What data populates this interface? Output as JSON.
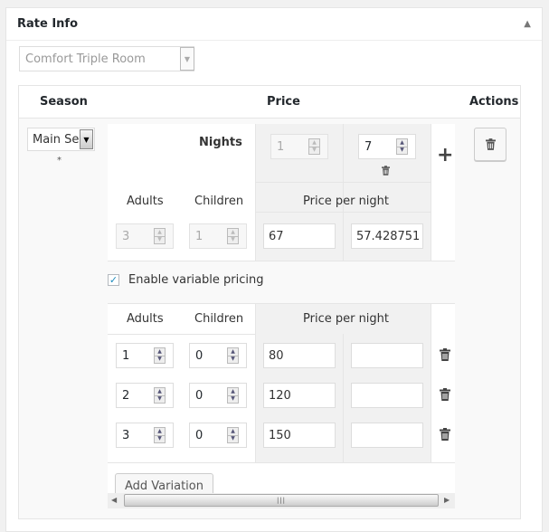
{
  "panel": {
    "title": "Rate Info",
    "collapse_icon": "triangle-up-icon"
  },
  "room_select": {
    "value": "Comfort Triple Room"
  },
  "table": {
    "headers": {
      "season": "Season",
      "price": "Price",
      "actions": "Actions"
    },
    "season_select": {
      "value": "Main Se",
      "required_mark": "*"
    },
    "nights": {
      "label": "Nights",
      "columns": [
        {
          "value": "1",
          "disabled": true
        },
        {
          "value": "7",
          "disabled": false
        }
      ],
      "add_icon": "+"
    },
    "base": {
      "adults_label": "Adults",
      "children_label": "Children",
      "price_per_night_label": "Price per night",
      "adults_value": "3",
      "children_value": "1",
      "prices": [
        "67",
        "57.428751"
      ]
    },
    "variable_pricing": {
      "checkbox_label": "Enable variable pricing",
      "checked": true,
      "adults_label": "Adults",
      "children_label": "Children",
      "price_per_night_label": "Price per night",
      "rows": [
        {
          "adults": "1",
          "children": "0",
          "price1": "80",
          "price2": ""
        },
        {
          "adults": "2",
          "children": "0",
          "price1": "120",
          "price2": ""
        },
        {
          "adults": "3",
          "children": "0",
          "price1": "150",
          "price2": ""
        }
      ],
      "add_button": "Add Variation"
    }
  }
}
